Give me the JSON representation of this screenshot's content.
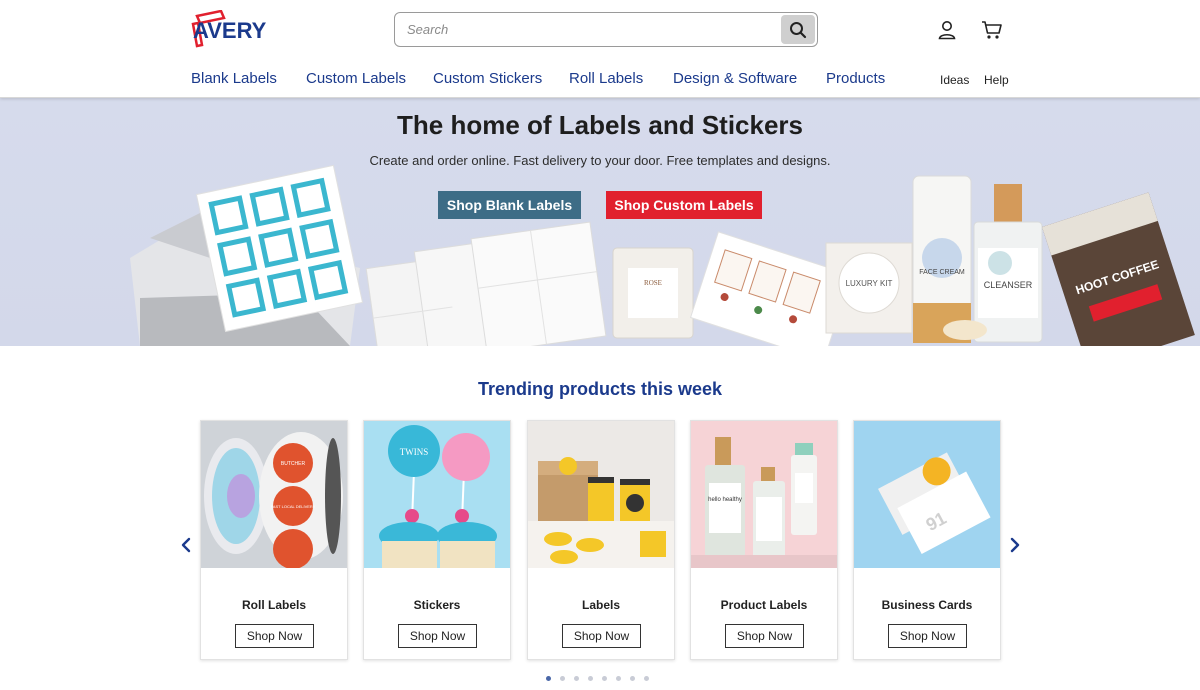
{
  "header": {
    "logo_text": "AVERY",
    "search": {
      "placeholder": "Search"
    },
    "nav": [
      {
        "label": "Blank Labels"
      },
      {
        "label": "Custom Labels"
      },
      {
        "label": "Custom Stickers"
      },
      {
        "label": "Roll Labels"
      },
      {
        "label": "Design & Software"
      },
      {
        "label": "Products"
      },
      {
        "label": "Ideas"
      },
      {
        "label": "Help"
      }
    ],
    "icons": [
      "search-icon",
      "user-icon",
      "cart-icon"
    ]
  },
  "hero": {
    "title": "The home of Labels and Stickers",
    "subtitle": "Create and order online. Fast delivery to your door. Free templates and designs.",
    "primary_button": "Shop Blank Labels",
    "secondary_button": "Shop Custom Labels",
    "product_texts": {
      "luxury_kit": "LUXURY KIT",
      "face_cream": "FACE CREAM",
      "cleanser": "CLEANSER",
      "coffee": "HOOT COFFEE",
      "rose": "ROSE"
    },
    "colors": {
      "background": "#d6dbec",
      "blank_button": "#3d6c86",
      "custom_button": "#e1202e"
    }
  },
  "trending": {
    "title": "Trending products this week",
    "cards": [
      {
        "name": "Roll Labels",
        "button": "Shop Now",
        "image_texts": [
          "BUTCHER",
          "FAST LOCAL DELIVERY"
        ]
      },
      {
        "name": "Stickers",
        "button": "Shop Now",
        "image_texts": [
          "TWINS"
        ]
      },
      {
        "name": "Labels",
        "button": "Shop Now",
        "image_texts": []
      },
      {
        "name": "Product Labels",
        "button": "Shop Now",
        "image_texts": [
          "hello healthy"
        ]
      },
      {
        "name": "Business Cards",
        "button": "Shop Now",
        "image_texts": [
          "91"
        ]
      }
    ],
    "pagination": {
      "pages": 8,
      "active": 1
    }
  },
  "colors": {
    "brand_blue": "#1b3a8c",
    "logo_red": "#e1202e"
  }
}
